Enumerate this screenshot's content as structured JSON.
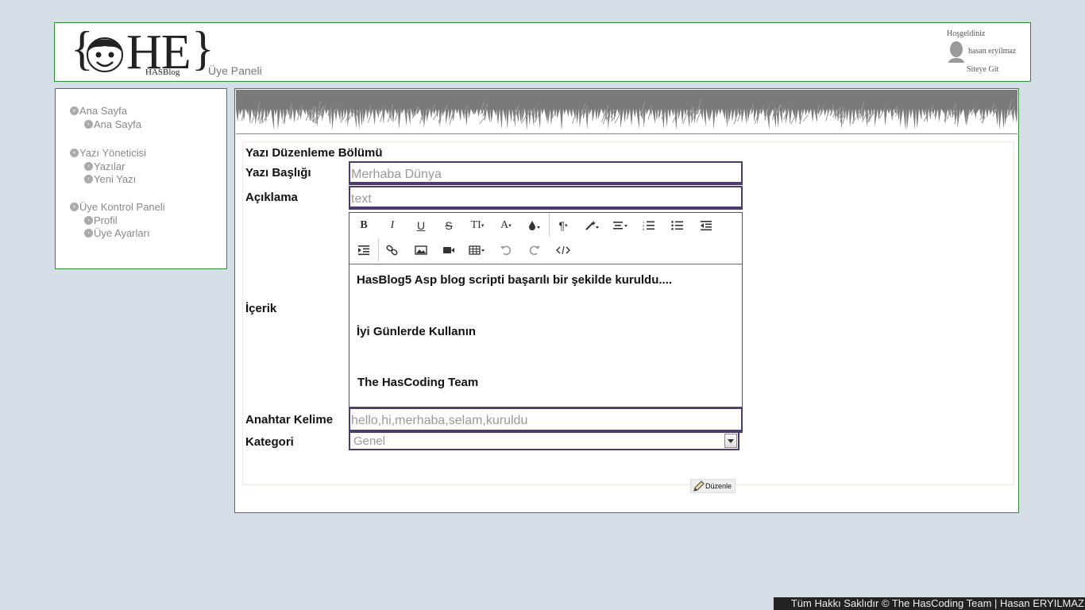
{
  "header": {
    "logo_left_brace": "{",
    "logo_right_brace": "}",
    "logo_text": "HE",
    "logo_face_label": "HAS",
    "logo_sub": "HASBlog",
    "panel_title": "Üye Paneli"
  },
  "user": {
    "welcome": "Hoşgeldiniz",
    "name": "hasan eryilmaz",
    "site_link": "Siteye Git"
  },
  "sidebar": {
    "groups": [
      {
        "label": "Ana Sayfa",
        "items": [
          {
            "label": "Ana Sayfa"
          }
        ]
      },
      {
        "label": "Yazı Yöneticisi",
        "items": [
          {
            "label": "Yazılar"
          },
          {
            "label": "Yeni Yazı"
          }
        ]
      },
      {
        "label": "Üye Kontrol Paneli",
        "items": [
          {
            "label": "Profil"
          },
          {
            "label": "Üye Ayarları"
          }
        ]
      }
    ]
  },
  "form": {
    "section_title": "Yazı Düzenleme Bölümü",
    "title_label": "Yazı Başlığı",
    "title_value": "Merhaba Dünya",
    "desc_label": "Açıklama",
    "desc_value": "text",
    "content_label": "İçerik",
    "content_lines": [
      "HasBlog5 Asp blog scripti başarılı bir şekilde kuruldu....",
      "İyi Günlerde Kullanın",
      "The HasCoding Team"
    ],
    "keywords_label": "Anahtar Kelime",
    "keywords_value": "hello,hi,merhaba,selam,kuruldu",
    "category_label": "Kategori",
    "category_value": "Genel",
    "submit_label": "Düzenle"
  },
  "toolbar": {
    "bold": "B",
    "italic": "I",
    "underline": "U",
    "strike": "S",
    "fontsize": "TI",
    "fontname": "A"
  },
  "footer": {
    "text": "Tüm Hakkı Saklıdır © The HasCoding Team | Hasan ERYILMAZ"
  },
  "colors": {
    "border_green": "#2e8b3a",
    "input_border": "#4b3b6e",
    "page_bg": "#d5dde6"
  }
}
